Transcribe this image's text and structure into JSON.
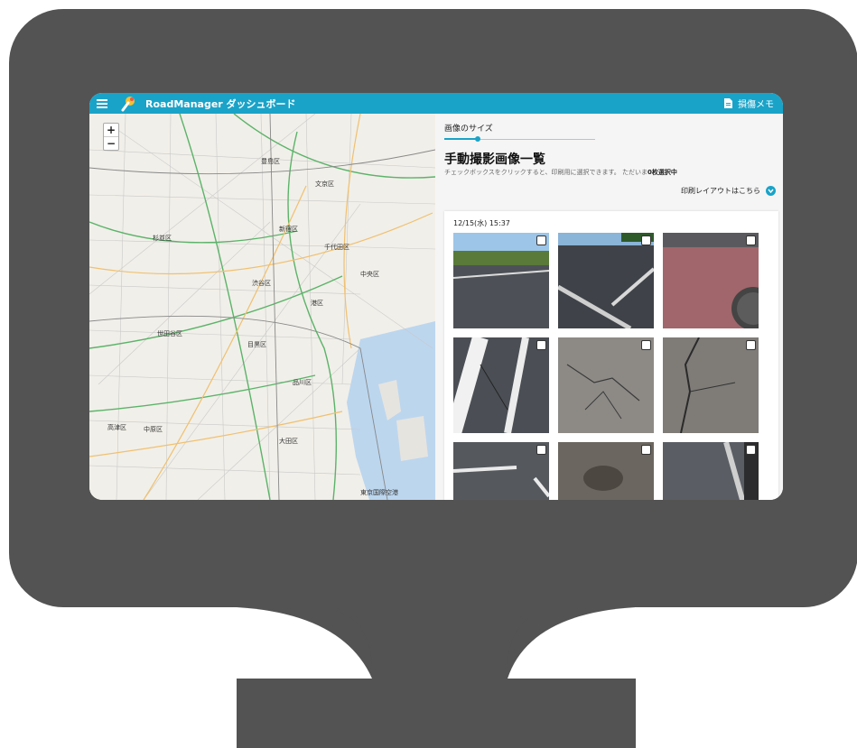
{
  "app": {
    "title": "RoadManager ダッシュボード",
    "memo_label": "損傷メモ"
  },
  "map": {
    "zoom_in": "+",
    "zoom_out": "−",
    "labels": [
      "豊島区",
      "文京区",
      "新宿区",
      "杉並区",
      "渋谷区",
      "港区",
      "品川区",
      "世田谷区",
      "目黒区",
      "大田区",
      "高津区",
      "中原区",
      "千代田区",
      "中央区",
      "東京国際空港"
    ]
  },
  "panel": {
    "size_label": "画像のサイズ",
    "slider_value": 0.22,
    "heading": "手動撮影画像一覧",
    "desc_prefix": "チェックボックスをクリックすると、印刷用に選択できます。 ただいま",
    "desc_count": "0枚選択中",
    "print_link": "印刷レイアウトはこちら"
  },
  "group": {
    "date": "12/15(水) 15:37"
  },
  "colors": {
    "accent": "#1aa3c8",
    "monitor": "#535353"
  }
}
